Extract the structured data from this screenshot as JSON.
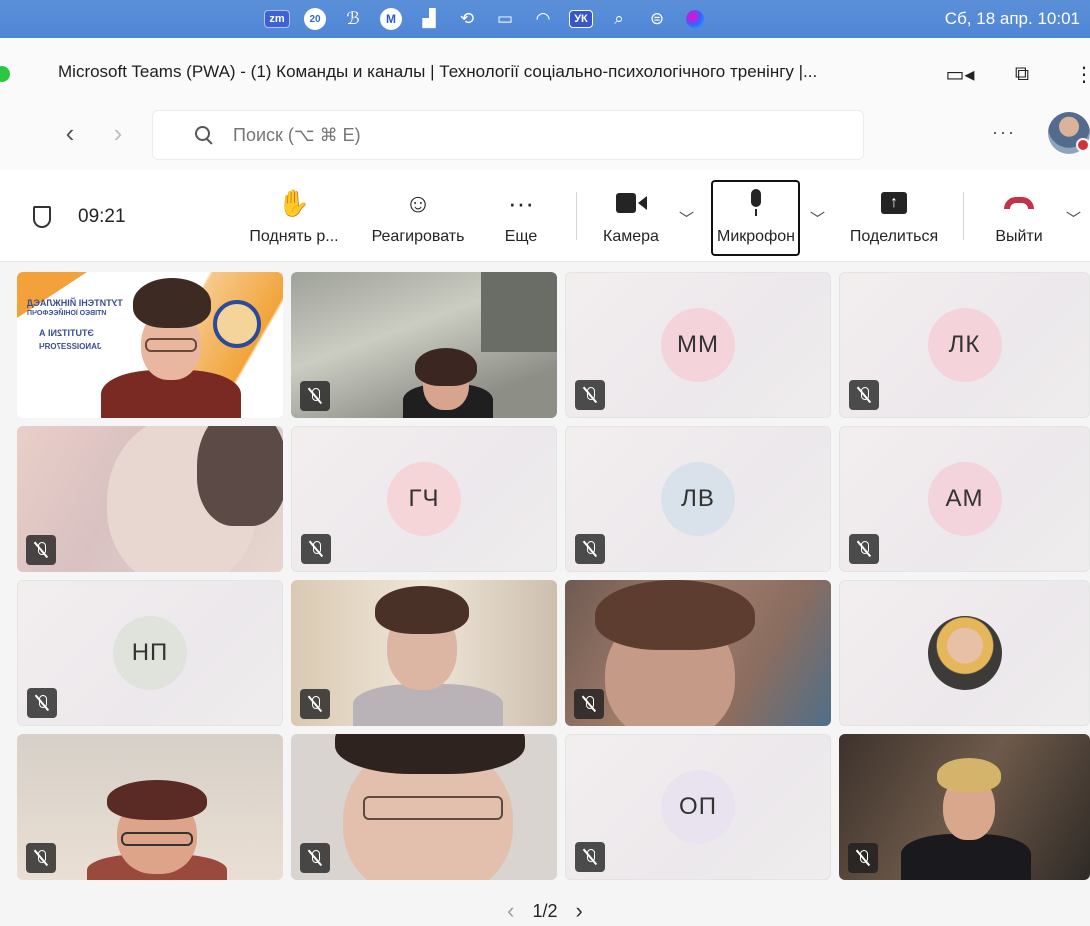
{
  "menubar": {
    "icons": [
      "zoom-badge",
      "calendar-badge",
      "script-icon",
      "mail-badge",
      "stocks-icon",
      "history-icon",
      "battery-icon",
      "wifi-icon",
      "language-badge",
      "search-icon",
      "control-center-icon",
      "siri-icon"
    ],
    "zoom_label": "zm",
    "calendar_label": "20",
    "mail_label": "M",
    "language_label": "УК",
    "clock": "Сб, 18 апр. 10:01"
  },
  "window": {
    "title": "Microsoft Teams (PWA) - (1) Команды и каналы | Технології соціально-психологічного тренінгу |..."
  },
  "search": {
    "placeholder": "Поиск (⌥ ⌘ E)"
  },
  "toolbar": {
    "timer": "09:21",
    "raise_hand": "Поднять р...",
    "react": "Реагировать",
    "more": "Еще",
    "camera": "Камера",
    "microphone": "Микрофон",
    "share": "Поделиться",
    "leave": "Выйти"
  },
  "tiles": [
    {
      "type": "presenter",
      "muted": false
    },
    {
      "type": "video",
      "muted": true
    },
    {
      "type": "initials",
      "initials": "ММ",
      "color": "#f4d3db",
      "muted": true
    },
    {
      "type": "initials",
      "initials": "ЛК",
      "color": "#f4d3db",
      "muted": true
    },
    {
      "type": "video",
      "muted": true
    },
    {
      "type": "initials",
      "initials": "ГЧ",
      "color": "#f6d5d8",
      "muted": true
    },
    {
      "type": "initials",
      "initials": "ЛВ",
      "color": "#d9e2ea",
      "muted": true
    },
    {
      "type": "initials",
      "initials": "АМ",
      "color": "#f3d3dc",
      "muted": true
    },
    {
      "type": "initials",
      "initials": "НП",
      "color": "#dfe3dc",
      "muted": true
    },
    {
      "type": "video",
      "muted": true
    },
    {
      "type": "video",
      "muted": true
    },
    {
      "type": "photo-avatar",
      "muted": false
    },
    {
      "type": "video",
      "muted": true
    },
    {
      "type": "video",
      "muted": true
    },
    {
      "type": "initials",
      "initials": "ОП",
      "color": "#e8e3ef",
      "muted": true
    },
    {
      "type": "video",
      "muted": true
    }
  ],
  "presenter_slide": {
    "line1": "ТУТИТЄНІ ЙІНЖЛАЄД",
    "line2": "ИТІВЄО ЇОНІЙЄЄФОЧП",
    "line3": "ЭТUTIT2NI А",
    "line4": "JANOIƧƧƎ7ОЯЧ "
  },
  "pager": {
    "label": "1/2"
  }
}
